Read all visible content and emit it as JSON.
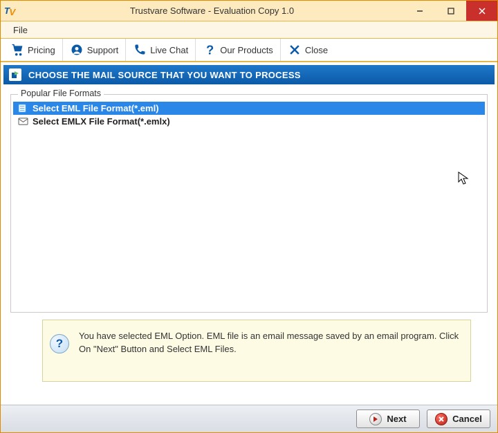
{
  "window": {
    "title": "Trustvare Software - Evaluation Copy 1.0"
  },
  "menubar": {
    "file": "File"
  },
  "toolbar": {
    "pricing": "Pricing",
    "support": "Support",
    "livechat": "Live Chat",
    "products": "Our Products",
    "close": "Close"
  },
  "step": {
    "heading": "CHOOSE THE MAIL SOURCE THAT YOU WANT TO PROCESS"
  },
  "formats": {
    "legend": "Popular File Formats",
    "items": [
      {
        "label": "Select EML File Format(*.eml)",
        "selected": true
      },
      {
        "label": "Select EMLX File Format(*.emlx)",
        "selected": false
      }
    ]
  },
  "info": {
    "text": "You have selected EML Option. EML file is an email message saved by an email program. Click On \"Next\" Button and Select EML Files."
  },
  "footer": {
    "next": "Next",
    "cancel": "Cancel"
  }
}
